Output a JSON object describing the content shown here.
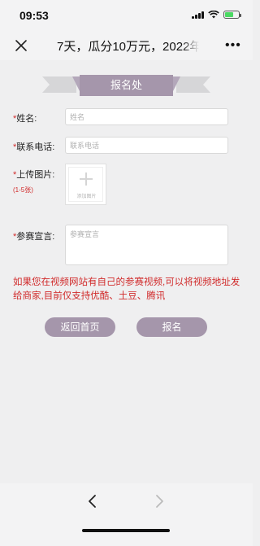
{
  "status_bar": {
    "time": "09:53"
  },
  "nav": {
    "title": "7天，瓜分10万元，2022年",
    "close_icon": "close-icon",
    "more_icon": "more-icon"
  },
  "banner": {
    "title": "报名处"
  },
  "form": {
    "name_label": "姓名:",
    "name_placeholder": "姓名",
    "phone_label": "联系电话:",
    "phone_placeholder": "联系电话",
    "upload_label": "上传图片:",
    "upload_hint": "(1-5张)",
    "upload_button_text": "添加图片",
    "declaration_label": "参赛宣言:",
    "declaration_placeholder": "参赛宣言",
    "required_mark": "*"
  },
  "notice": "如果您在视频网站有自己的参赛视频,可以将视频地址发给商家,目前仅支持优酷、土豆、腾讯",
  "buttons": {
    "back_home": "返回首页",
    "submit": "报名"
  },
  "colors": {
    "accent": "#a596ab",
    "required": "#d12b2b",
    "background": "#efeff0"
  }
}
